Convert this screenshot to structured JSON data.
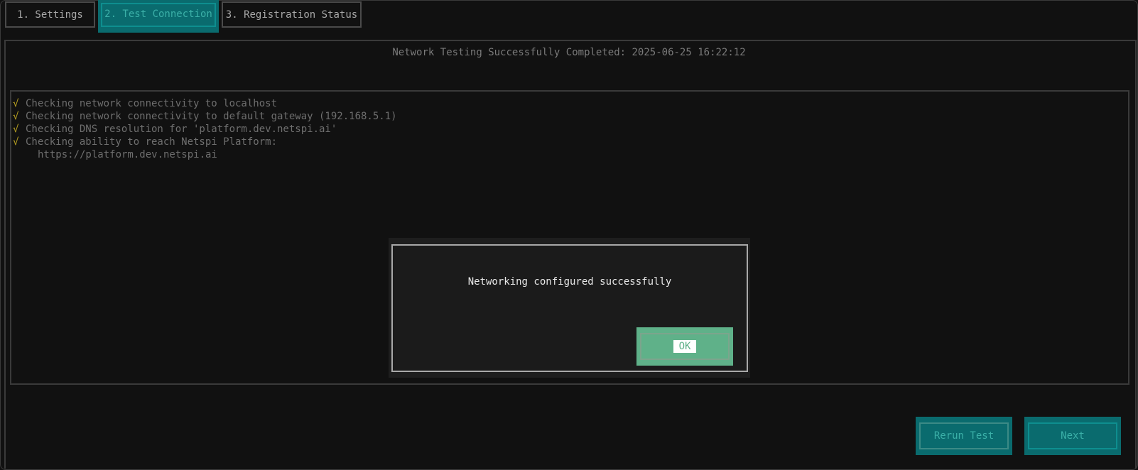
{
  "tabs": [
    {
      "label": "1. Settings"
    },
    {
      "label": "2. Test Connection"
    },
    {
      "label": "3. Registration Status"
    }
  ],
  "main": {
    "status_heading": "Network Testing Successfully Completed: 2025-06-25 16:22:12",
    "checks": [
      {
        "mark": "√",
        "text": "Checking network connectivity to localhost"
      },
      {
        "mark": "√",
        "text": "Checking network connectivity to default gateway (192.168.5.1)"
      },
      {
        "mark": "√",
        "text": "Checking DNS resolution for 'platform.dev.netspi.ai'"
      },
      {
        "mark": "√",
        "text": "Checking ability to reach Netspi Platform:"
      }
    ],
    "check_continuation": "https://platform.dev.netspi.ai"
  },
  "dialog": {
    "message": "Networking configured successfully",
    "ok_label": "OK"
  },
  "actions": {
    "rerun_label": "Rerun Test",
    "next_label": "Next"
  },
  "colors": {
    "background": "#111111",
    "active_tab": "#0a6b6e",
    "active_text": "#3bb0a8",
    "check_mark": "#b8a021",
    "ok_button": "#5fb189"
  }
}
